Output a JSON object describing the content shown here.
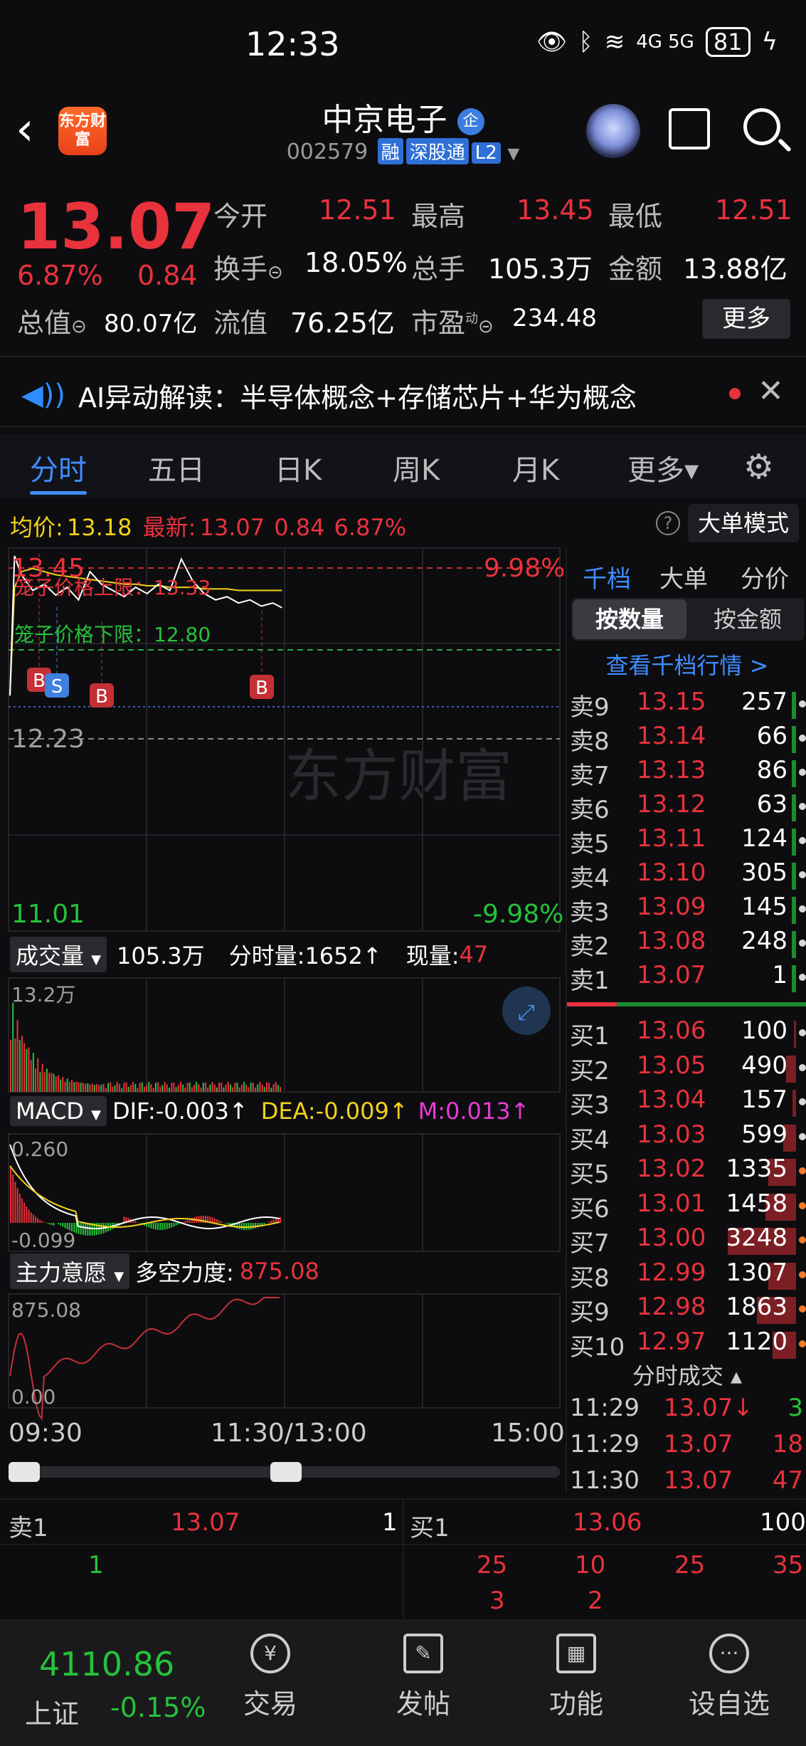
{
  "status_bar": {
    "time": "12:33",
    "network": "4G 5G",
    "battery": "81"
  },
  "header": {
    "back_glyph": "‹",
    "logo_text": "东方财富",
    "stock_name": "中京电子",
    "name_badge": "企",
    "code": "002579",
    "tags": [
      "融",
      "深股通",
      "L2"
    ]
  },
  "quote": {
    "price": "13.07",
    "pct": "6.87%",
    "change": "0.84",
    "open_label": "今开",
    "open": "12.51",
    "high_label": "最高",
    "high": "13.45",
    "low_label": "最低",
    "low": "12.51",
    "turnover_label": "换手",
    "turnover": "18.05%",
    "volume_label": "总手",
    "volume": "105.3万",
    "amount_label": "金额",
    "amount": "13.88亿",
    "mktcap_label": "总值",
    "mktcap": "80.07亿",
    "float_label": "流值",
    "float": "76.25亿",
    "pe_label": "市盈",
    "pe_sup": "动",
    "pe": "234.48",
    "more": "更多"
  },
  "ai": {
    "text": "AI异动解读：半导体概念+存储芯片+华为概念"
  },
  "tabs": [
    "分时",
    "五日",
    "日K",
    "周K",
    "月K",
    "更多▾"
  ],
  "avg_row": {
    "avg_label": "均价:",
    "avg": "13.18",
    "latest_label": "最新:",
    "latest": "13.07",
    "chg": "0.84",
    "pct": "6.87%",
    "mode": "大单模式"
  },
  "chart": {
    "price_top": "13.45",
    "price_mid": "12.23",
    "price_bot": "11.01",
    "pct_top": "9.98%",
    "pct_bot": "-9.98%",
    "cage_upper": "笼子价格上限：13.33",
    "cage_lower": "笼子价格下限：12.80",
    "watermark": "东方财富",
    "vol_label": "成交量",
    "vol_total": "105.3万",
    "vol_tick_label": "分时量:1652↑",
    "vol_now_label": "现量:",
    "vol_now": "47",
    "vol_max": "13.2万",
    "macd_label": "MACD",
    "dif": "DIF:-0.003↑",
    "dea": "DEA:-0.009↑",
    "m": "M:0.013↑",
    "macd_top": "0.260",
    "macd_bot": "-0.099",
    "zl_label": "主力意愿",
    "zl_text": "多空力度:",
    "zl_val": "875.08",
    "zl_top": "875.08",
    "zl_bot": "0.00",
    "t_start": "09:30",
    "t_mid": "11:30/13:00",
    "t_end": "15:00",
    "markers": [
      "B",
      "S",
      "B",
      "B"
    ]
  },
  "chart_data": {
    "type": "line",
    "title": "",
    "xlabel": "",
    "ylabel": "",
    "ylim": [
      11.01,
      13.45
    ],
    "x": [
      "09:30",
      "09:32",
      "09:35",
      "09:40",
      "09:45",
      "09:50",
      "09:55",
      "10:00",
      "10:05",
      "10:10",
      "10:15",
      "10:20",
      "10:25",
      "10:30",
      "10:35",
      "10:40",
      "10:45",
      "10:50",
      "10:55",
      "11:00",
      "11:05",
      "11:10",
      "11:15",
      "11:20",
      "11:25",
      "11:29"
    ],
    "series": [
      {
        "values": [
          12.51,
          13.4,
          13.28,
          13.18,
          13.22,
          13.15,
          13.2,
          13.12,
          13.3,
          13.22,
          13.18,
          13.14,
          13.2,
          13.16,
          13.22,
          13.18,
          13.38,
          13.24,
          13.16,
          13.12,
          13.14,
          13.1,
          13.12,
          13.08,
          13.1,
          13.07
        ]
      },
      {
        "values": [
          12.51,
          13.2,
          13.3,
          13.32,
          13.3,
          13.28,
          13.27,
          13.26,
          13.25,
          13.24,
          13.23,
          13.22,
          13.22,
          13.21,
          13.21,
          13.2,
          13.2,
          13.2,
          13.19,
          13.19,
          13.19,
          13.18,
          13.18,
          13.18,
          13.18,
          13.18
        ]
      }
    ]
  },
  "book": {
    "tabs": [
      "千档",
      "大单",
      "分价"
    ],
    "seg_on": "按数量",
    "seg_off": "按金额",
    "view_depth": "查看千档行情 >",
    "asks": [
      {
        "label": "卖9",
        "price": "13.15",
        "vol": "257"
      },
      {
        "label": "卖8",
        "price": "13.14",
        "vol": "66"
      },
      {
        "label": "卖7",
        "price": "13.13",
        "vol": "86"
      },
      {
        "label": "卖6",
        "price": "13.12",
        "vol": "63"
      },
      {
        "label": "卖5",
        "price": "13.11",
        "vol": "124"
      },
      {
        "label": "卖4",
        "price": "13.10",
        "vol": "305"
      },
      {
        "label": "卖3",
        "price": "13.09",
        "vol": "145"
      },
      {
        "label": "卖2",
        "price": "13.08",
        "vol": "248"
      },
      {
        "label": "卖1",
        "price": "13.07",
        "vol": "1"
      }
    ],
    "bids": [
      {
        "label": "买1",
        "price": "13.06",
        "vol": "100"
      },
      {
        "label": "买2",
        "price": "13.05",
        "vol": "490"
      },
      {
        "label": "买3",
        "price": "13.04",
        "vol": "157"
      },
      {
        "label": "买4",
        "price": "13.03",
        "vol": "599"
      },
      {
        "label": "买5",
        "price": "13.02",
        "vol": "1335"
      },
      {
        "label": "买6",
        "price": "13.01",
        "vol": "1458"
      },
      {
        "label": "买7",
        "price": "13.00",
        "vol": "3248"
      },
      {
        "label": "买8",
        "price": "12.99",
        "vol": "1307"
      },
      {
        "label": "买9",
        "price": "12.98",
        "vol": "1863"
      },
      {
        "label": "买10",
        "price": "12.97",
        "vol": "1120"
      }
    ],
    "ticks_title": "分时成交 ▴",
    "ticks": [
      {
        "time": "11:29",
        "price": "13.07↓",
        "vol": "3"
      },
      {
        "time": "11:29",
        "price": "13.07",
        "vol": "18"
      },
      {
        "time": "11:30",
        "price": "13.07",
        "vol": "47"
      }
    ]
  },
  "bidask": {
    "ask_label": "卖1",
    "ask_price": "13.07",
    "ask_vol": "1",
    "bid_label": "买1",
    "bid_price": "13.06",
    "bid_vol": "100",
    "ask_queue": [
      "1"
    ],
    "bid_queue_row1": [
      "25",
      "10",
      "25",
      "35"
    ],
    "bid_queue_row2": [
      "3",
      "2"
    ]
  },
  "nav": {
    "index_value": "4110.86",
    "index_name": "上证",
    "index_pct": "-0.15%",
    "items": [
      {
        "label": "交易",
        "icon": "¥"
      },
      {
        "label": "发帖",
        "icon": "✎"
      },
      {
        "label": "功能",
        "icon": "▦"
      },
      {
        "label": "设自选",
        "icon": "···"
      }
    ]
  }
}
